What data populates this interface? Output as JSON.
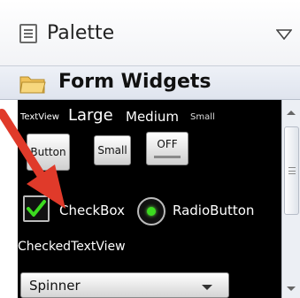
{
  "palette": {
    "title": "Palette",
    "icon": "list-icon",
    "collapse_icon": "triangle-down-icon"
  },
  "section": {
    "title": "Form Widgets",
    "icon": "folder-icon"
  },
  "widgets": {
    "textviews": [
      "TextView",
      "Large",
      "Medium",
      "Small"
    ],
    "buttons": {
      "button": "Button",
      "small": "Small",
      "toggle": "OFF"
    },
    "checkbox": {
      "label": "CheckBox",
      "checked": true
    },
    "radio": {
      "label": "RadioButton",
      "selected": true
    },
    "checked_text_view": "CheckedTextView",
    "spinner": {
      "label": "Spinner"
    }
  },
  "colors": {
    "annotation": "#e03a2a",
    "checkmark": "#3cdc20",
    "widget_bg": "#000000"
  }
}
